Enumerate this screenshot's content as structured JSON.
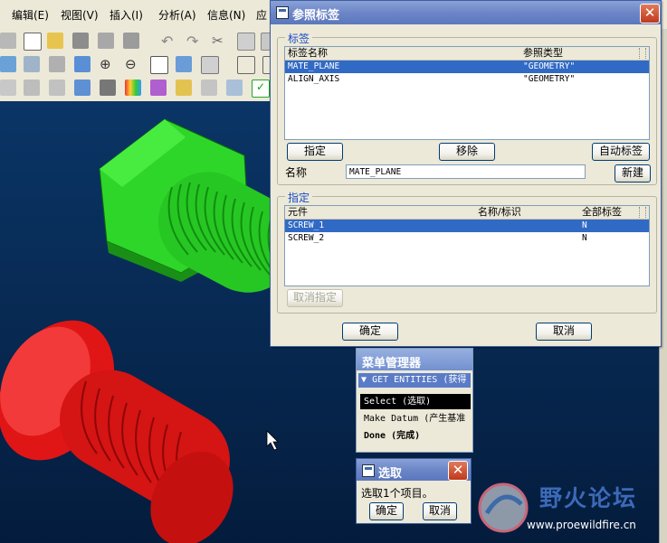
{
  "menubar": {
    "items": [
      "编辑(E)",
      "视图(V)",
      "插入(I)",
      "分析(A)",
      "信息(N)",
      "应"
    ]
  },
  "toolbar": {
    "icons": [
      "regenerate-icon",
      "new-icon",
      "open-icon",
      "save-icon",
      "save-copy-icon",
      "print-icon",
      "undo-icon",
      "redo-icon",
      "cut-icon",
      "copy-icon",
      "paste-icon",
      "rotate-icon",
      "layers-icon",
      "model-tree-icon",
      "repaint-icon",
      "zoom-in-icon",
      "zoom-out-icon",
      "refit-icon",
      "spin-icon",
      "datum-display-icon",
      "view-icon",
      "orient-icon",
      "measure-icon",
      "section-icon",
      "curve-icon",
      "shading-icon",
      "appearance-icon",
      "sketch-icon",
      "family-table-icon",
      "relations-icon",
      "layer-icon",
      "check-icon"
    ]
  },
  "ref_dialog": {
    "title": "参照标签",
    "close": "✕",
    "tags_group": {
      "legend": "标签",
      "columns": [
        "标签名称",
        "参照类型"
      ],
      "rows": [
        {
          "name": "MATE_PLANE",
          "type": "\"GEOMETRY\"",
          "selected": true
        },
        {
          "name": "ALIGN_AXIS",
          "type": "\"GEOMETRY\"",
          "selected": false
        }
      ],
      "assign_button": "指定",
      "remove_button": "移除",
      "auto_tag_button": "自动标签",
      "name_label": "名称",
      "name_value": "MATE_PLANE",
      "new_button": "新建"
    },
    "assign_group": {
      "legend": "指定",
      "columns": [
        "元件",
        "名称/标识",
        "全部标签"
      ],
      "rows": [
        {
          "component": "SCREW_1",
          "name_id": "",
          "all_tags": "N",
          "selected": true
        },
        {
          "component": "SCREW_2",
          "name_id": "",
          "all_tags": "N",
          "selected": false
        }
      ],
      "unassign_button": "取消指定"
    },
    "ok_button": "确定",
    "cancel_button": "取消"
  },
  "menu_manager": {
    "title": "菜单管理器",
    "submenu": "GET ENTITIES (获得",
    "items": [
      {
        "label": "Select (选取)",
        "active": true
      },
      {
        "label": "Make Datum (产生基准",
        "active": false
      },
      {
        "label": "Done (完成)",
        "active": false
      }
    ]
  },
  "select_dialog": {
    "title": "选取",
    "close": "✕",
    "message": "选取1个项目。",
    "ok_button": "确定",
    "cancel_button": "取消"
  },
  "watermark": {
    "title": "野火论坛",
    "url": "www.proewildfire.cn"
  },
  "colors": {
    "viewport_bg": "#07284f",
    "bolt_green": "#22c21c",
    "screw_red": "#d31212",
    "selection": "#316ac5",
    "legend_blue": "#1b4bc8"
  }
}
